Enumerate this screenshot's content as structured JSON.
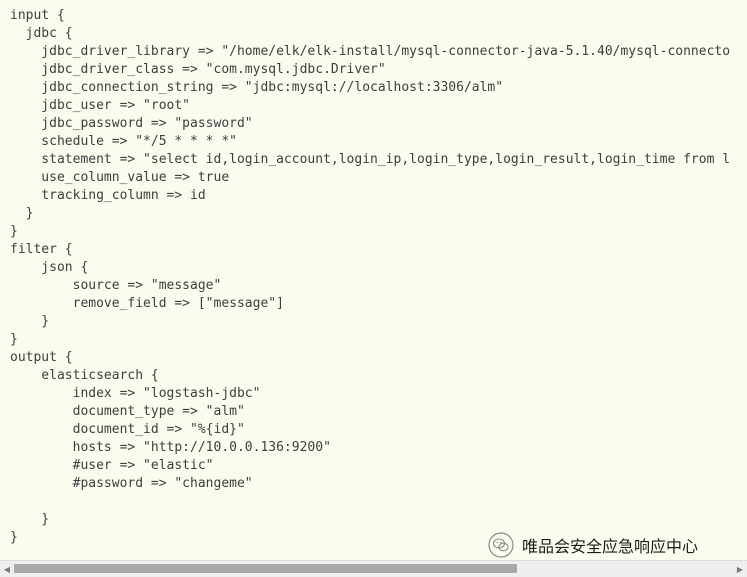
{
  "code": {
    "lines": [
      "input {",
      "  jdbc {",
      "    jdbc_driver_library => \"/home/elk/elk-install/mysql-connector-java-5.1.40/mysql-connecto",
      "    jdbc_driver_class => \"com.mysql.jdbc.Driver\"",
      "    jdbc_connection_string => \"jdbc:mysql://localhost:3306/alm\"",
      "    jdbc_user => \"root\"",
      "    jdbc_password => \"password\"",
      "    schedule => \"*/5 * * * *\"",
      "    statement => \"select id,login_account,login_ip,login_type,login_result,login_time from l",
      "    use_column_value => true",
      "    tracking_column => id",
      "  }",
      "}",
      "filter {",
      "    json {",
      "        source => \"message\"",
      "        remove_field => [\"message\"]",
      "    }",
      "}",
      "output {",
      "    elasticsearch {",
      "        index => \"logstash-jdbc\"",
      "        document_type => \"alm\"",
      "        document_id => \"%{id}\"",
      "        hosts => \"http://10.0.0.136:9200\"",
      "        #user => \"elastic\"",
      "        #password => \"changeme\"",
      "",
      "    }",
      "}"
    ]
  },
  "watermark": {
    "text": "唯品会安全应急响应中心",
    "icon": "wechat-icon"
  },
  "scrollbar": {
    "left_arrow": "◀",
    "right_arrow": "▶",
    "thumb_fraction": 0.7
  },
  "colors": {
    "background": "#fcfbf0",
    "text": "#3e3e3e",
    "scrollbar_track": "#efefef",
    "scrollbar_thumb": "#a9a9a9"
  }
}
